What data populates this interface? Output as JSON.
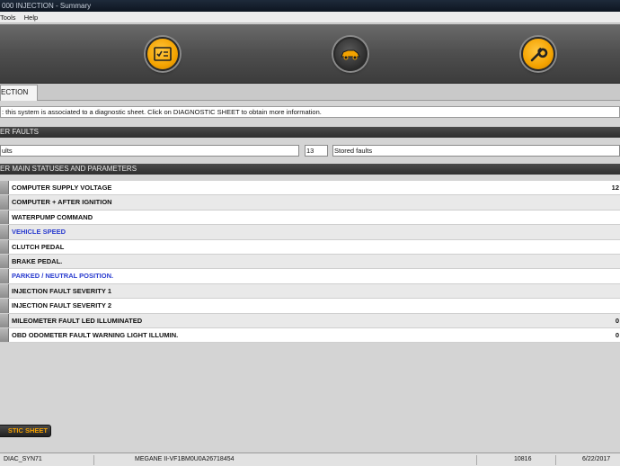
{
  "window": {
    "title": "000 INJECTION - Summary"
  },
  "menu": {
    "items": [
      "Tools",
      "Help"
    ]
  },
  "toolbar": {
    "buttons": [
      {
        "icon": "checklist-icon"
      },
      {
        "icon": "car-icon"
      },
      {
        "icon": "wrench-icon"
      }
    ],
    "accent": "#f4a300"
  },
  "tab": {
    "label": "ECTION"
  },
  "info": {
    "text": ": this system is associated to a diagnostic sheet. Click on DIAGNOSTIC SHEET to obtain more information."
  },
  "faults_section": {
    "title": "ER FAULTS",
    "left_field": "ults",
    "count": "13",
    "filter": "Stored faults"
  },
  "params_section": {
    "title": "ER MAIN STATUSES AND PARAMETERS"
  },
  "rows": [
    {
      "label": "COMPUTER SUPPLY VOLTAGE",
      "value": "12",
      "blue": false
    },
    {
      "label": "COMPUTER + AFTER IGNITION",
      "value": "",
      "blue": false
    },
    {
      "label": "WATERPUMP COMMAND",
      "value": "",
      "blue": false
    },
    {
      "label": "VEHICLE SPEED",
      "value": "",
      "blue": true
    },
    {
      "label": "CLUTCH PEDAL",
      "value": "",
      "blue": false
    },
    {
      "label": "BRAKE PEDAL.",
      "value": "",
      "blue": false
    },
    {
      "label": "PARKED / NEUTRAL POSITION.",
      "value": "",
      "blue": true
    },
    {
      "label": "INJECTION FAULT SEVERITY 1",
      "value": "",
      "blue": false
    },
    {
      "label": "INJECTION FAULT SEVERITY 2",
      "value": "",
      "blue": false
    },
    {
      "label": "MILEOMETER FAULT LED ILLUMINATED",
      "value": "0",
      "blue": false
    },
    {
      "label": "OBD ODOMETER FAULT WARNING LIGHT ILLUMIN.",
      "value": "0",
      "blue": false
    }
  ],
  "diag_button": {
    "label": "STIC SHEET"
  },
  "status": {
    "left": "DIAC_SYN71",
    "vehicle": "MEGANE II-VF1BM0U0A26718454",
    "code": "10816",
    "date": "6/22/2017"
  }
}
